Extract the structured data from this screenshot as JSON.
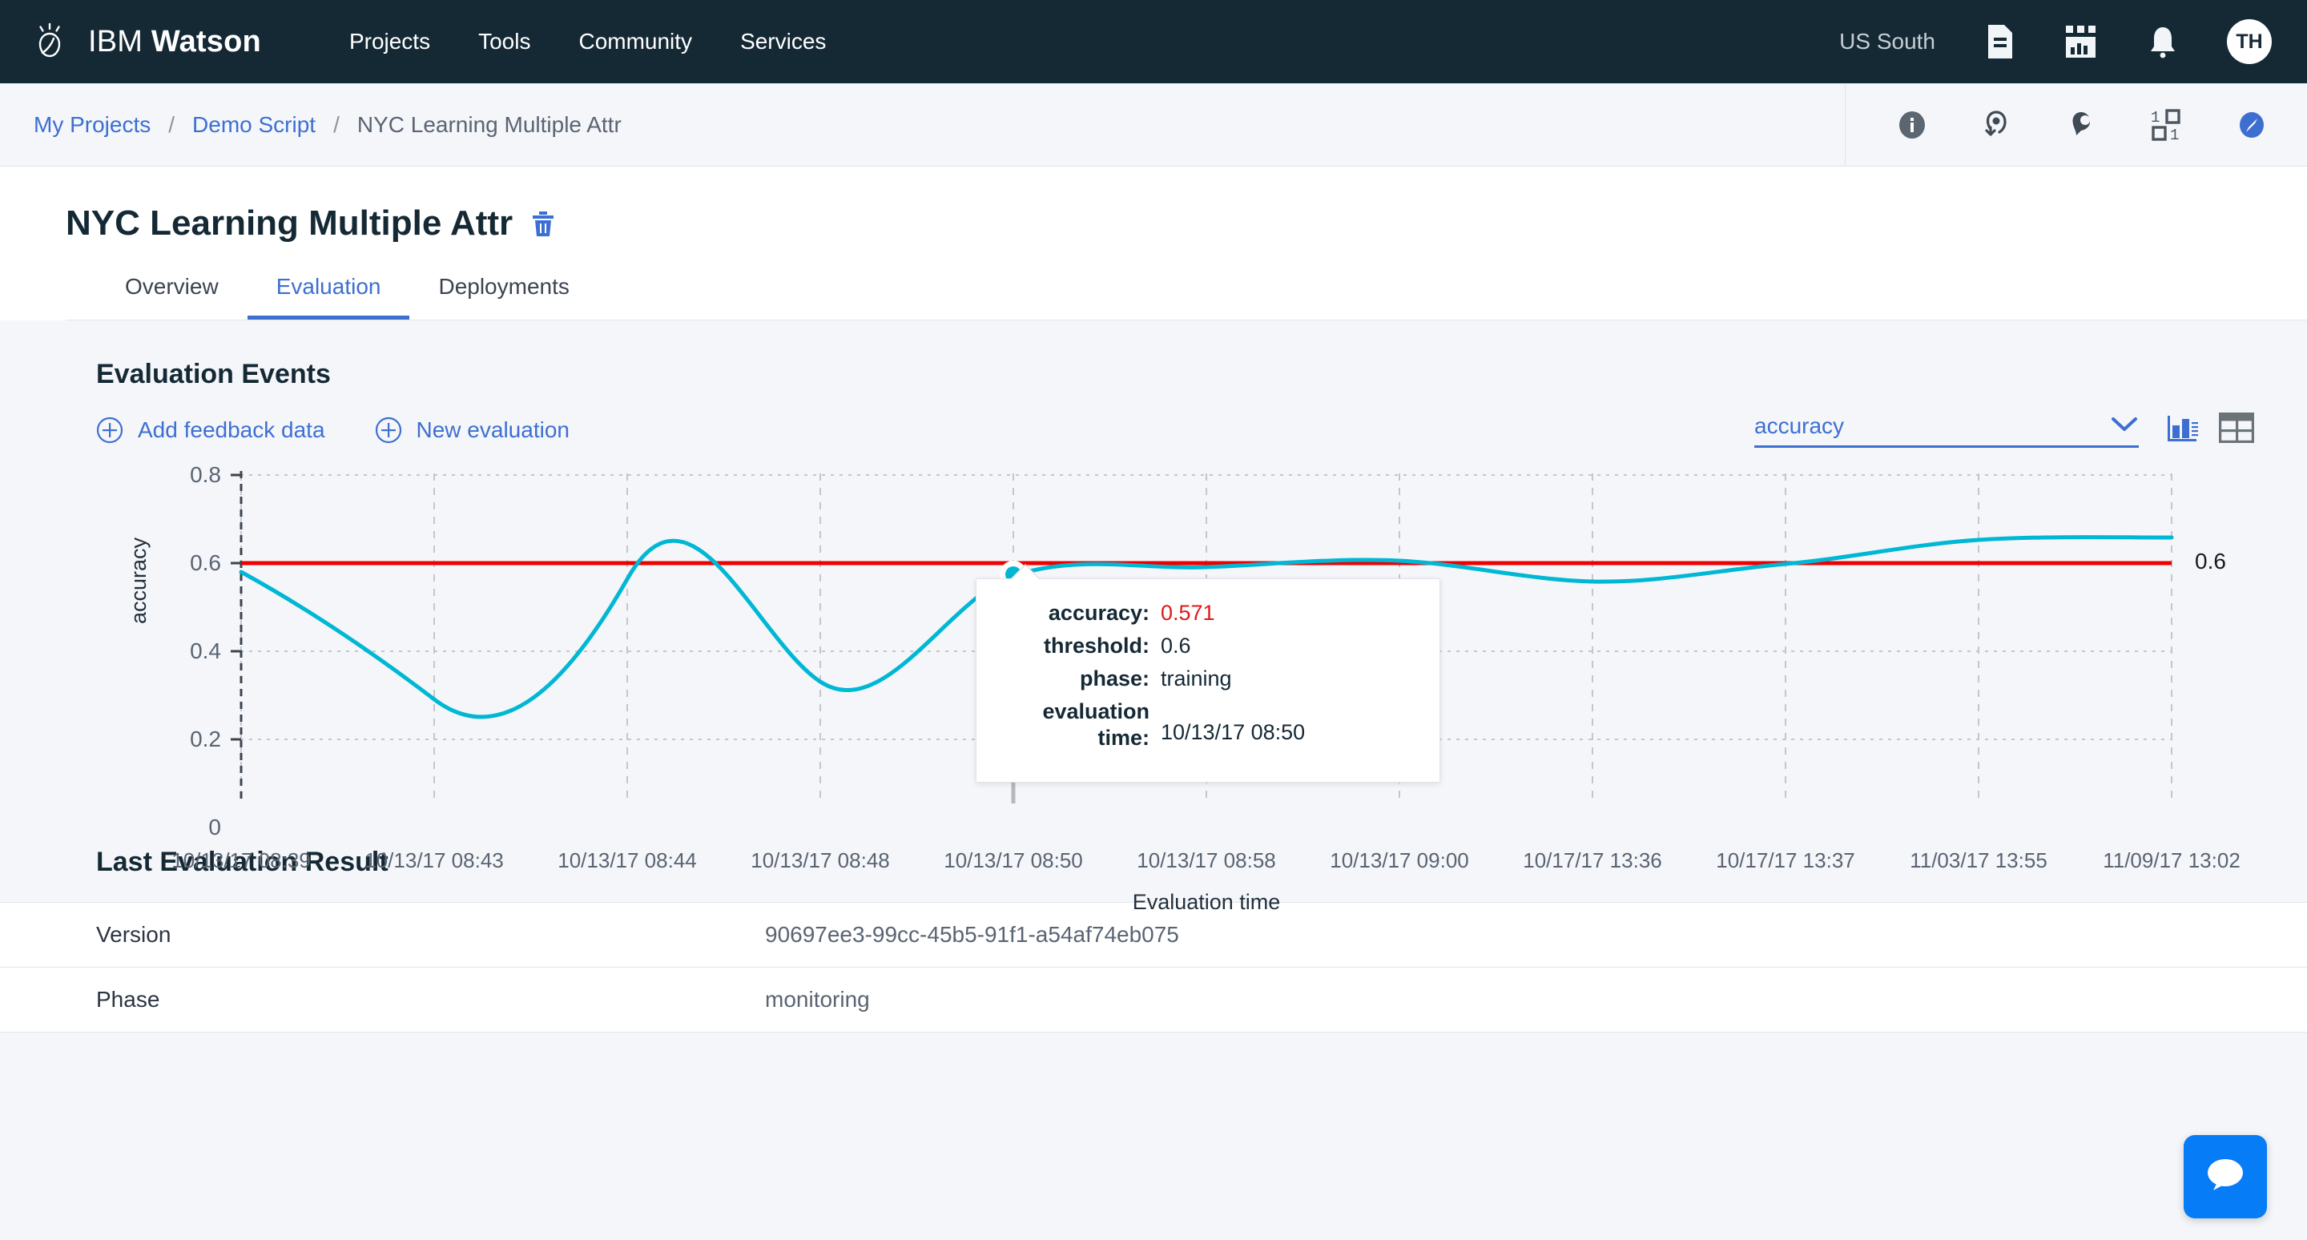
{
  "topnav": {
    "brand_prefix": "IBM ",
    "brand_name": "Watson",
    "logo_icon": "watson-lightbulb-icon",
    "links": [
      {
        "label": "Projects"
      },
      {
        "label": "Tools"
      },
      {
        "label": "Community"
      },
      {
        "label": "Services"
      }
    ],
    "region": "US South",
    "icons": [
      {
        "name": "document-icon"
      },
      {
        "name": "dashboard-chart-icon"
      },
      {
        "name": "notification-bell-icon"
      }
    ],
    "avatar_initials": "TH",
    "bg_color": "#152935"
  },
  "breadcrumb": {
    "items": [
      {
        "label": "My Projects",
        "link": true
      },
      {
        "label": "Demo Script",
        "link": true
      },
      {
        "label": "NYC Learning Multiple Attr",
        "link": false
      }
    ],
    "separator": "/",
    "actions": [
      {
        "name": "info-icon"
      },
      {
        "name": "pin-outline-icon"
      },
      {
        "name": "pin-filled-icon"
      },
      {
        "name": "binary-data-icon"
      },
      {
        "name": "compass-icon"
      }
    ]
  },
  "page": {
    "title": "NYC Learning Multiple Attr",
    "delete_icon": "trash-icon",
    "tabs": [
      {
        "label": "Overview",
        "active": false
      },
      {
        "label": "Evaluation",
        "active": true
      },
      {
        "label": "Deployments",
        "active": false
      }
    ]
  },
  "evaluation": {
    "section_title": "Evaluation Events",
    "actions": [
      {
        "label": "Add feedback data",
        "icon": "plus-circle-icon"
      },
      {
        "label": "New evaluation",
        "icon": "plus-circle-icon"
      }
    ],
    "metric_select": {
      "value": "accuracy",
      "chevron_icon": "chevron-down-icon"
    },
    "view_toggle": [
      {
        "name": "bar-chart-view-icon",
        "active": true
      },
      {
        "name": "table-view-icon",
        "active": false
      }
    ]
  },
  "tooltip": {
    "rows": [
      {
        "key": "accuracy:",
        "value": "0.571",
        "accent": true
      },
      {
        "key": "threshold:",
        "value": "0.6",
        "accent": false
      },
      {
        "key": "phase:",
        "value": "training",
        "accent": false
      },
      {
        "key": "evaluation time:",
        "value": "10/13/17 08:50",
        "accent": false
      }
    ]
  },
  "last_result": {
    "title": "Last Evaluation Result",
    "rows": [
      {
        "label": "Version",
        "value": "90697ee3-99cc-45b5-91f1-a54af74eb075"
      },
      {
        "label": "Phase",
        "value": "monitoring"
      }
    ]
  },
  "chat": {
    "icon": "chat-bubble-icon",
    "color": "#067cf7"
  },
  "chart_data": {
    "type": "line",
    "title": "",
    "xlabel": "Evaluation time",
    "ylabel": "accuracy",
    "ylim": [
      0,
      0.85
    ],
    "yticks": [
      0,
      0.2,
      0.4,
      0.6,
      0.8
    ],
    "ytick_labels": [
      "0",
      "0.2",
      "0.4",
      "0.6",
      "0.8"
    ],
    "grid": true,
    "legend": "none",
    "categories": [
      "10/13/17 08:39",
      "10/13/17 08:43",
      "10/13/17 08:44",
      "10/13/17 08:48",
      "10/13/17 08:50",
      "10/13/17 08:58",
      "10/13/17 09:00",
      "10/17/17 13:36",
      "10/17/17 13:37",
      "11/03/17 13:55",
      "11/09/17 13:02"
    ],
    "series": [
      {
        "name": "accuracy",
        "color": "#00b7d4",
        "values": [
          0.58,
          0.29,
          0.57,
          0.34,
          0.571,
          0.575,
          0.6,
          0.605,
          0.57,
          0.6,
          0.63
        ]
      },
      {
        "name": "threshold",
        "color": "#ee0000",
        "values": [
          0.6,
          0.6,
          0.6,
          0.6,
          0.6,
          0.6,
          0.6,
          0.6,
          0.6,
          0.6,
          0.6
        ]
      }
    ],
    "threshold_label": "0.6",
    "highlight_point": {
      "category": "10/13/17 08:50",
      "value": 0.571
    }
  }
}
